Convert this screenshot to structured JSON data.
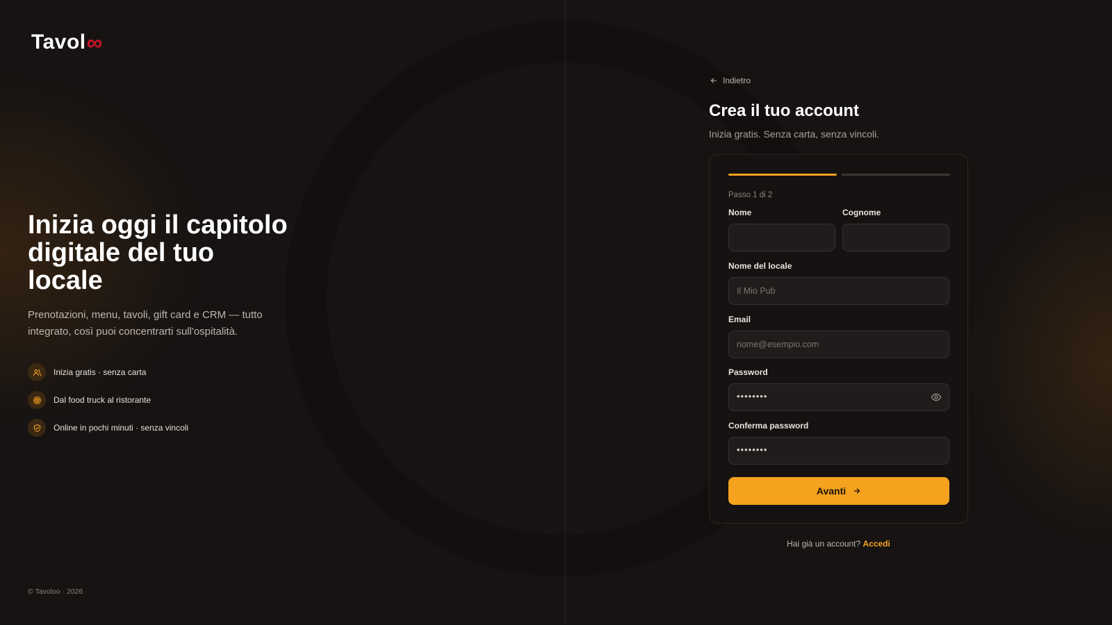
{
  "brand": {
    "name_prefix": "Tavol",
    "name_suffix": "∞"
  },
  "hero": {
    "title": "Inizia oggi il capitolo digitale del tuo locale",
    "subtitle": "Prenotazioni, menu, tavoli, gift card e CRM — tutto integrato, così puoi concentrarti sull'ospitalità.",
    "features": [
      {
        "icon": "users-icon",
        "label": "Inizia gratis · senza carta"
      },
      {
        "icon": "box-icon",
        "label": "Dal food truck al ristorante"
      },
      {
        "icon": "shield-icon",
        "label": "Online in pochi minuti · senza vincoli"
      }
    ]
  },
  "footer": {
    "copyright": "© Tavoloo · 2026"
  },
  "form": {
    "back_label": "Indietro",
    "title": "Crea il tuo account",
    "subtitle": "Inizia gratis. Senza carta, senza vincoli.",
    "step_label": "Passo 1 di 2",
    "progress": {
      "current_step": 1,
      "total_steps": 2
    },
    "fields": {
      "first_name": {
        "label": "Nome",
        "value": "",
        "placeholder": ""
      },
      "last_name": {
        "label": "Cognome",
        "value": "",
        "placeholder": ""
      },
      "venue_name": {
        "label": "Nome del locale",
        "value": "",
        "placeholder": "Il Mio Pub"
      },
      "email": {
        "label": "Email",
        "value": "",
        "placeholder": "nome@esempio.com"
      },
      "password": {
        "label": "Password",
        "value": "••••••••"
      },
      "confirm_password": {
        "label": "Conferma password",
        "value": "••••••••"
      }
    },
    "submit_label": "Avanti",
    "signin_prompt": "Hai già un account?",
    "signin_link": "Accedi"
  },
  "colors": {
    "accent": "#f5a21f",
    "brand_red": "#c8142a",
    "background": "#161312"
  }
}
